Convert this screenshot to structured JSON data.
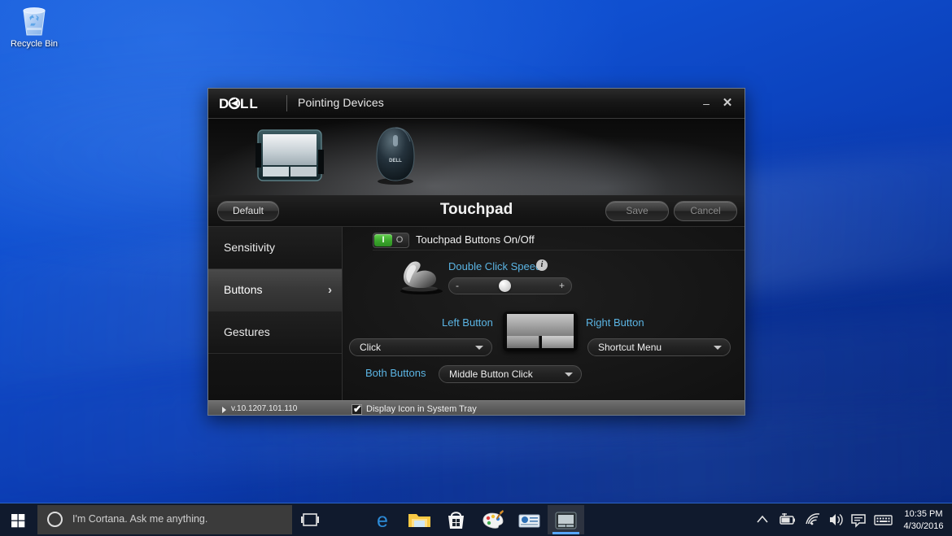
{
  "desktop": {
    "recycle_bin": {
      "label": "Recycle Bin",
      "icon": "recycle-bin-icon"
    }
  },
  "window": {
    "brand": "DELL",
    "title": "Pointing Devices",
    "minimize_label": "–",
    "close_label": "✕",
    "banner": {
      "touchpad_icon": "touchpad-device-icon",
      "mouse_icon": "mouse-device-icon"
    },
    "header": {
      "default_label": "Default",
      "page_title": "Touchpad",
      "save_label": "Save",
      "cancel_label": "Cancel"
    },
    "sidebar": {
      "items": [
        {
          "label": "Sensitivity",
          "active": false
        },
        {
          "label": "Buttons",
          "active": true
        },
        {
          "label": "Gestures",
          "active": false
        }
      ],
      "chevron": "›"
    },
    "content": {
      "toggle": {
        "on_label": "I",
        "off_label": "O",
        "state": "on",
        "label": "Touchpad Buttons On/Off"
      },
      "double_click": {
        "label": "Double Click Speed",
        "info_glyph": "i",
        "minus_label": "-",
        "plus_label": "+",
        "value_percent": 50
      },
      "left_button": {
        "label": "Left Button",
        "selected": "Click"
      },
      "right_button": {
        "label": "Right Button",
        "selected": "Shortcut Menu"
      },
      "both_buttons": {
        "label": "Both Buttons",
        "selected": "Middle Button Click"
      },
      "arrow_glyph": "▼"
    },
    "statusbar": {
      "version": "v.10.1207.101.110",
      "tray_checkbox_checked": true,
      "tray_checkbox_tick": "✔",
      "tray_label": "Display Icon in System Tray"
    }
  },
  "taskbar": {
    "start_icon": "windows-start-icon",
    "cortana": {
      "placeholder": "I'm Cortana. Ask me anything.",
      "circle_icon": "cortana-circle-icon"
    },
    "task_view_icon": "task-view-icon",
    "apps": [
      {
        "name": "edge-icon",
        "label": "Microsoft Edge"
      },
      {
        "name": "file-explorer-icon",
        "label": "File Explorer"
      },
      {
        "name": "store-icon",
        "label": "Microsoft Store"
      },
      {
        "name": "paint-icon",
        "label": "Paint"
      },
      {
        "name": "settings-icon",
        "label": "Control Panel"
      },
      {
        "name": "dell-touchpad-icon",
        "label": "Dell Pointing Devices"
      }
    ],
    "tray": [
      {
        "name": "chevron-up-icon"
      },
      {
        "name": "battery-icon"
      },
      {
        "name": "wifi-icon"
      },
      {
        "name": "volume-icon"
      },
      {
        "name": "action-center-icon"
      },
      {
        "name": "keyboard-icon"
      }
    ],
    "clock": {
      "time": "10:35 PM",
      "date": "4/30/2016"
    }
  },
  "colors": {
    "accent_blue": "#5bb4e3",
    "toggle_green": "#3aa62c",
    "desktop_blue": "#0f4fd0",
    "taskbar": "#101a2d"
  }
}
